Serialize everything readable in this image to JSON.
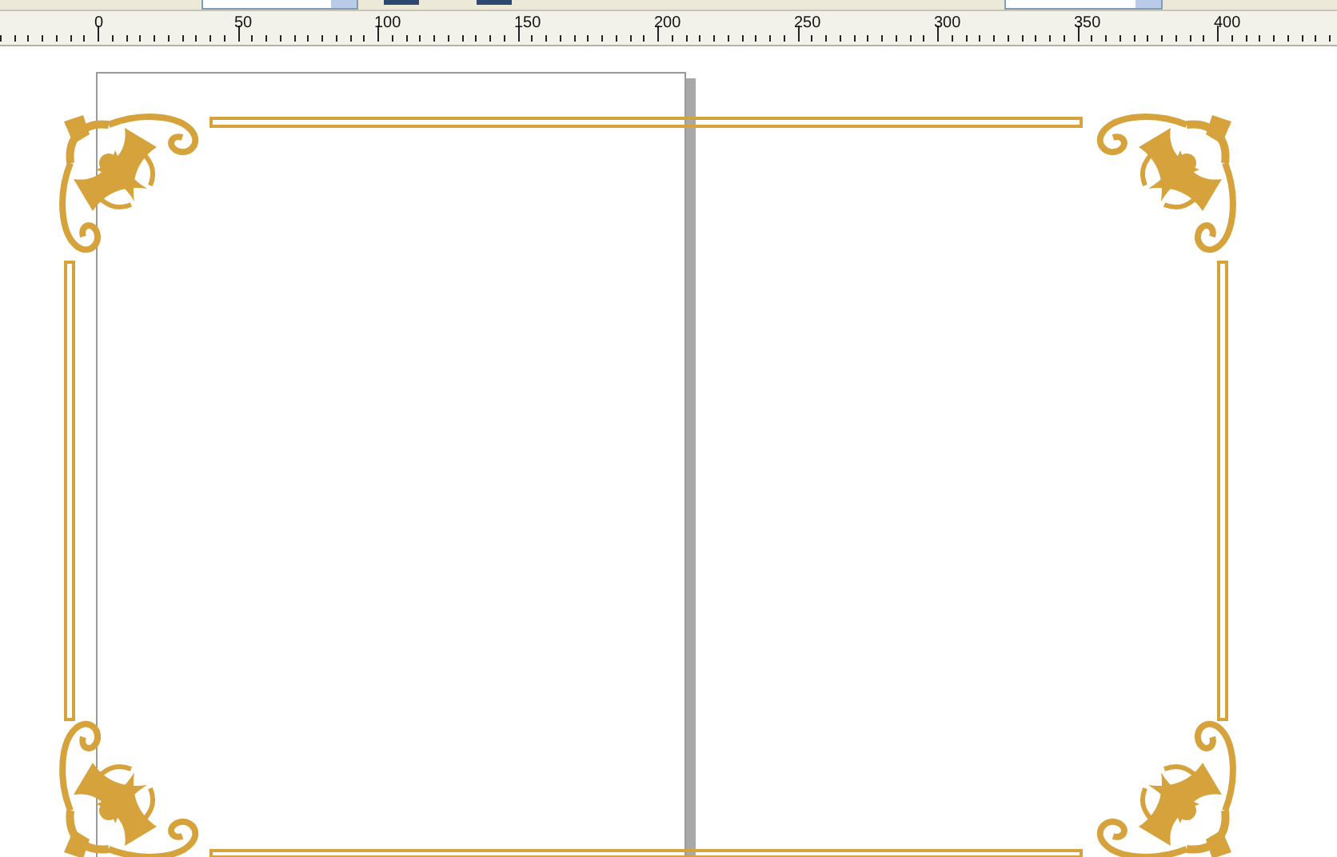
{
  "ruler": {
    "labels": [
      "0",
      "50",
      "100",
      "150",
      "200",
      "250",
      "300",
      "350",
      "400"
    ]
  }
}
